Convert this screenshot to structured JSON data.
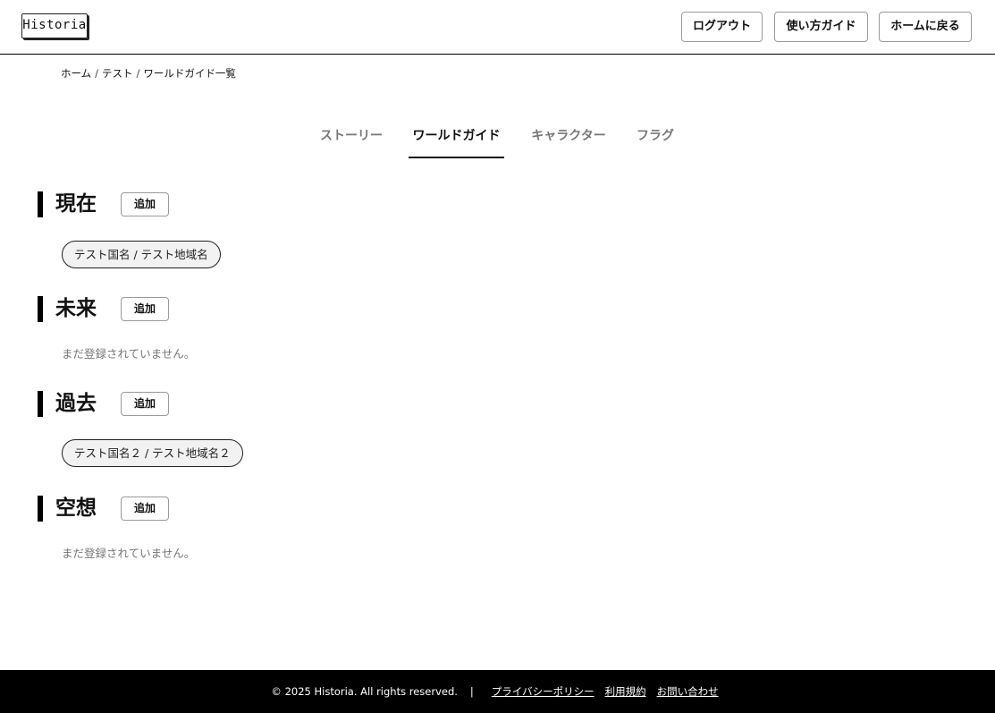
{
  "header": {
    "logo": "Historia",
    "buttons": {
      "logout": "ログアウト",
      "guide": "使い方ガイド",
      "home": "ホームに戻る"
    }
  },
  "breadcrumb": {
    "items": [
      "ホーム",
      "テスト",
      "ワールドガイド一覧"
    ],
    "separator": "/"
  },
  "tabs": [
    {
      "label": "ストーリー",
      "active": false
    },
    {
      "label": "ワールドガイド",
      "active": true
    },
    {
      "label": "キャラクター",
      "active": false
    },
    {
      "label": "フラグ",
      "active": false
    }
  ],
  "sections": [
    {
      "title": "現在",
      "add_label": "追加",
      "entries": [
        "テスト国名 / テスト地域名"
      ],
      "empty_text": ""
    },
    {
      "title": "未来",
      "add_label": "追加",
      "entries": [],
      "empty_text": "まだ登録されていません。"
    },
    {
      "title": "過去",
      "add_label": "追加",
      "entries": [
        "テスト国名２ / テスト地域名２"
      ],
      "empty_text": ""
    },
    {
      "title": "空想",
      "add_label": "追加",
      "entries": [],
      "empty_text": "まだ登録されていません。"
    }
  ],
  "footer": {
    "copyright": "© 2025 Historia. All rights reserved.",
    "divider": "|",
    "links": [
      "プライバシーポリシー",
      "利用規約",
      "お問い合わせ"
    ]
  },
  "colors": {
    "accent": "#000000",
    "inactive_tab": "#777777",
    "chip_background": "#f2f2f2",
    "empty_text": "#777777"
  }
}
